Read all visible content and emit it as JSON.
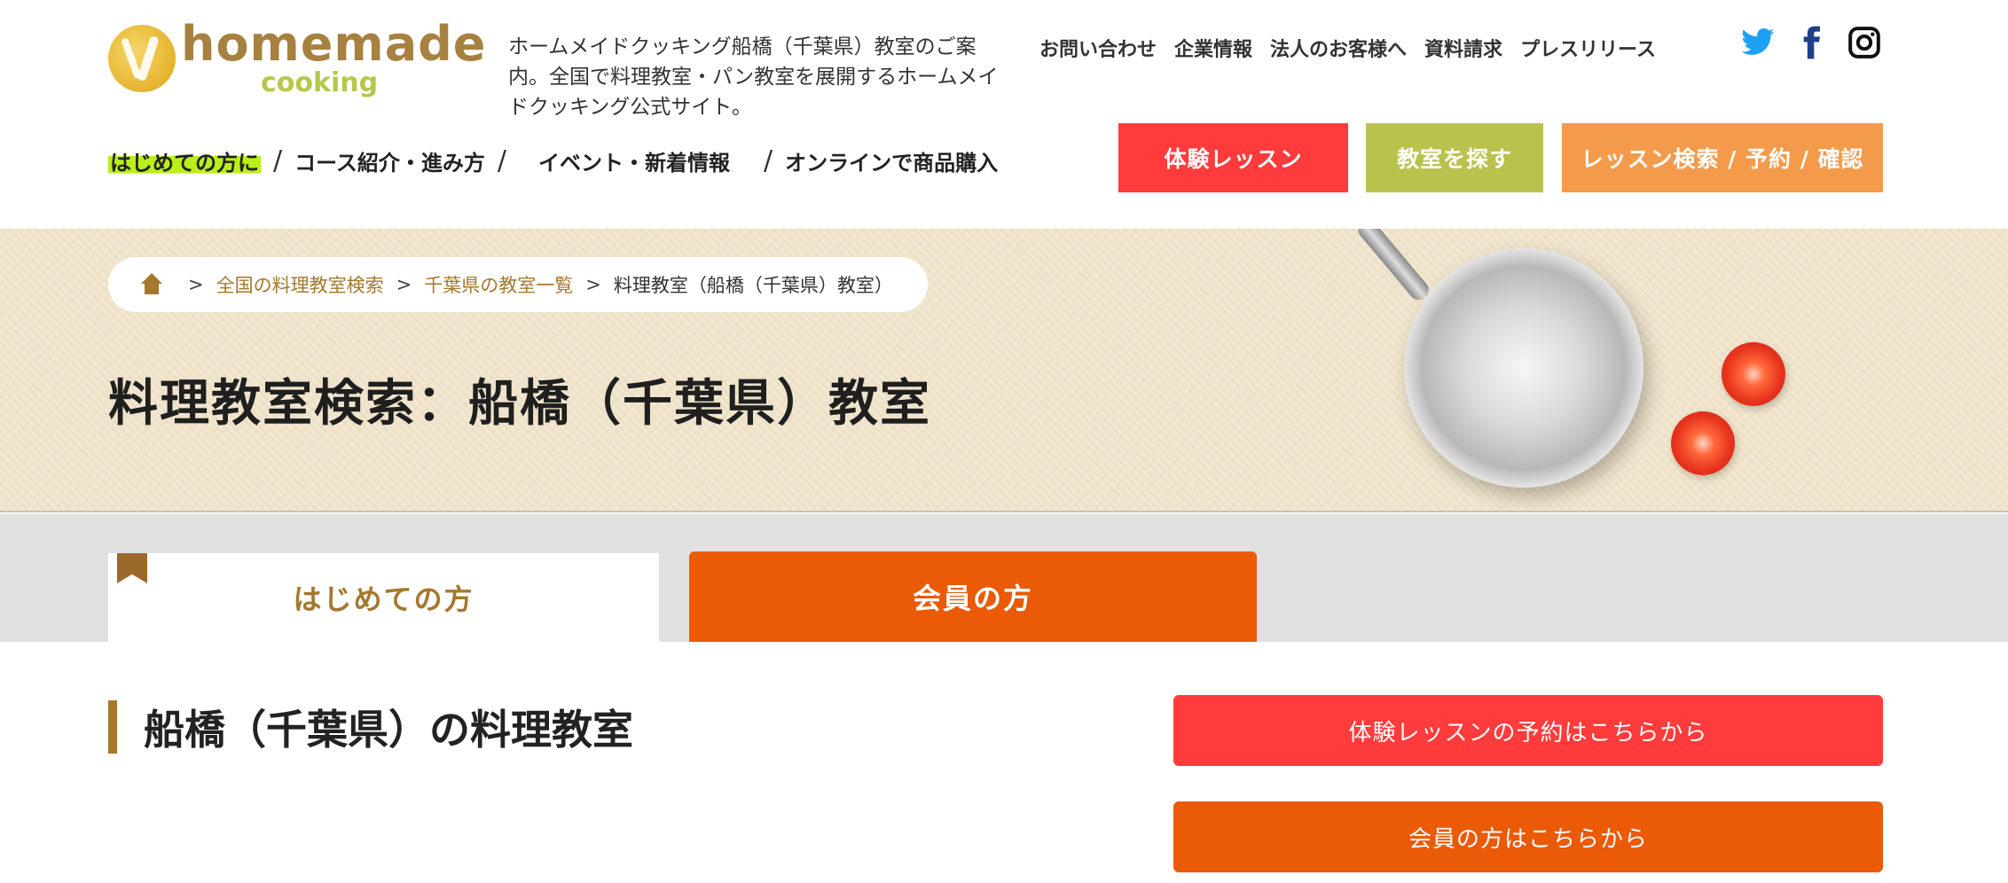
{
  "logo": {
    "main": "homemade",
    "sub": "cooking"
  },
  "header": {
    "description": "ホームメイドクッキング船橋（千葉県）教室のご案内。全国で料理教室・パン教室を展開するホームメイドクッキング公式サイト。",
    "top_links": [
      "お問い合わせ",
      "企業情報",
      "法人のお客様へ",
      "資料請求",
      "プレスリリース"
    ],
    "social": [
      "twitter-icon",
      "facebook-icon",
      "instagram-icon"
    ]
  },
  "nav": {
    "items": [
      "はじめての方に",
      "コース紹介・進み方",
      "イベント・新着情報",
      "オンラインで商品購入"
    ],
    "separator": "/"
  },
  "cta": {
    "trial": "体験レッスン",
    "find": "教室を探す",
    "search": "レッスン検索 / 予約 / 確認"
  },
  "breadcrumb": {
    "sep": ">",
    "items": [
      "全国の料理教室検索",
      "千葉県の教室一覧",
      "料理教室（船橋（千葉県）教室）"
    ]
  },
  "hero": {
    "title": "料理教室検索：船橋（千葉県）教室"
  },
  "tabs": {
    "first": "はじめての方",
    "member": "会員の方"
  },
  "main": {
    "section_title": "船橋（千葉県）の料理教室",
    "trial_button": "体験レッスンの予約はこちらから",
    "member_button": "会員の方はこちらから"
  },
  "colors": {
    "accent_brown": "#a5782e",
    "trial_red": "#ff3b3b",
    "member_orange": "#ea5a07",
    "find_green": "#bac24e",
    "search_orange": "#f39b4b",
    "nav_highlight": "#b9ef1a"
  }
}
